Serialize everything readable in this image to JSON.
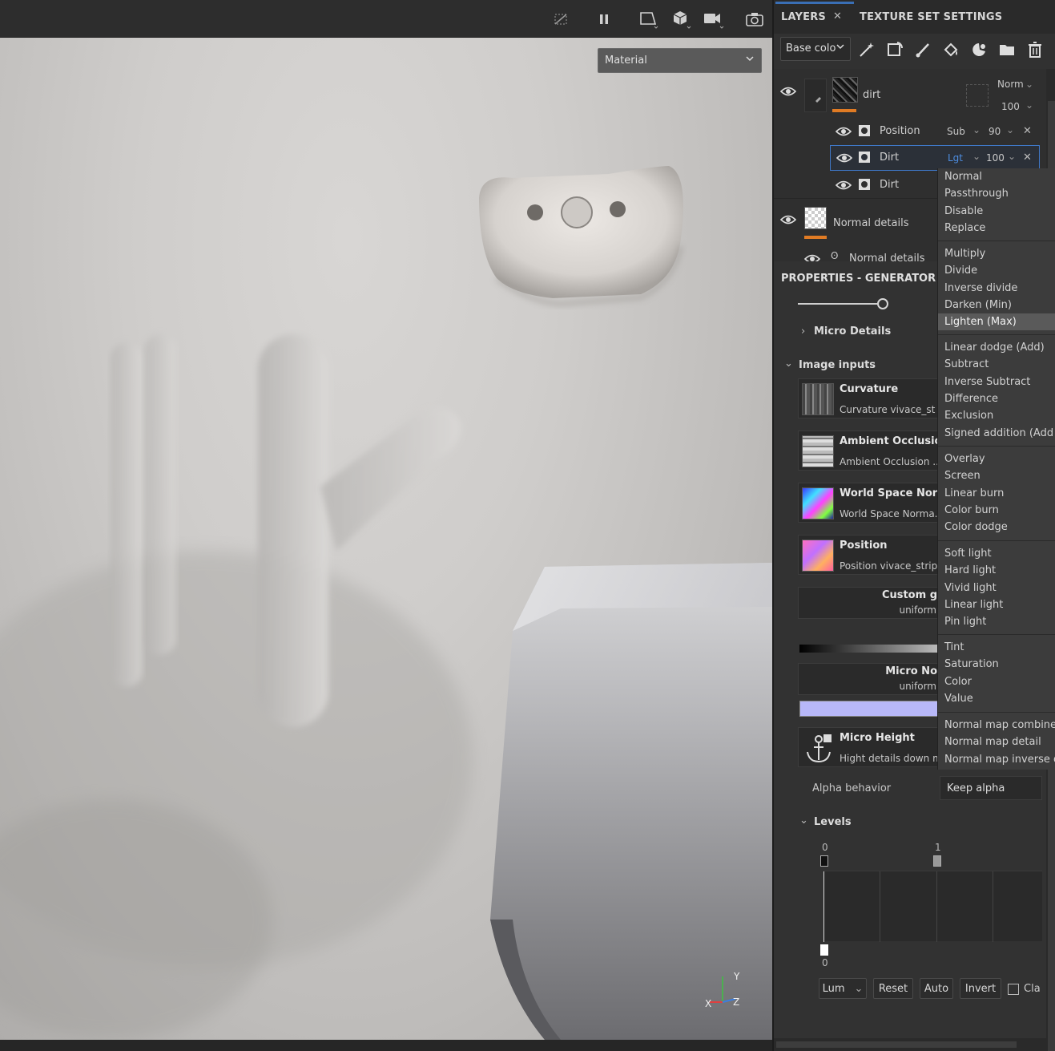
{
  "viewport": {
    "material_select": "Material",
    "axis": {
      "x": "X",
      "y": "Y",
      "z": "Z"
    }
  },
  "tabs": {
    "layers": "LAYERS",
    "texture_set": "TEXTURE SET SETTINGS"
  },
  "layer_toolbar": {
    "channel": "Base colo"
  },
  "layers": {
    "dirt": {
      "name": "dirt",
      "blend": "Norm",
      "opacity": "100"
    },
    "position": {
      "name": "Position",
      "blend": "Sub",
      "opacity": "90"
    },
    "dirt_selected": {
      "name": "Dirt",
      "blend": "Lgt",
      "opacity": "100"
    },
    "dirt_3": {
      "name": "Dirt"
    },
    "normal_details": {
      "name": "Normal details"
    },
    "normal_details_sub": {
      "name": "Normal details"
    }
  },
  "properties": {
    "header": "PROPERTIES - GENERATOR",
    "micro_details": "Micro Details",
    "image_inputs": "Image inputs",
    "inputs": [
      {
        "title": "Curvature",
        "sub": "Curvature vivace_st"
      },
      {
        "title": "Ambient Occlusio",
        "sub": "Ambient Occlusion ..."
      },
      {
        "title": "World Space Norn",
        "sub": "World Space Norma..."
      },
      {
        "title": "Position",
        "sub": "Position vivace_strip"
      }
    ],
    "custom": {
      "title": "Custom g",
      "sub": "uniform"
    },
    "micro_noise": {
      "title": "Micro No",
      "sub": "uniform"
    },
    "micro_height": {
      "title": "Micro Height",
      "sub": "Hight details down m"
    },
    "alpha_behavior_label": "Alpha behavior",
    "alpha_behavior_value": "Keep alpha",
    "levels": "Levels",
    "levels_top_0": "0",
    "levels_top_1": "1",
    "levels_bottom_0": "0",
    "buttons": {
      "lum": "Lum",
      "reset": "Reset",
      "auto": "Auto",
      "invert": "Invert",
      "clamp": "Cla"
    }
  },
  "blend_menu": {
    "groups": [
      [
        "Normal",
        "Passthrough",
        "Disable",
        "Replace"
      ],
      [
        "Multiply",
        "Divide",
        "Inverse divide",
        "Darken (Min)",
        "Lighten (Max)"
      ],
      [
        "Linear dodge (Add)",
        "Subtract",
        "Inverse Subtract",
        "Difference",
        "Exclusion",
        "Signed addition (Add"
      ],
      [
        "Overlay",
        "Screen",
        "Linear burn",
        "Color burn",
        "Color dodge"
      ],
      [
        "Soft light",
        "Hard light",
        "Vivid light",
        "Linear light",
        "Pin light"
      ],
      [
        "Tint",
        "Saturation",
        "Color",
        "Value"
      ],
      [
        "Normal map combine",
        "Normal map detail",
        "Normal map inverse d"
      ]
    ],
    "active": "Lighten (Max)"
  },
  "colors": {
    "accent": "#3f78c8",
    "layer_bar": "#e07b24",
    "micro_color": "#b8b8f8"
  }
}
